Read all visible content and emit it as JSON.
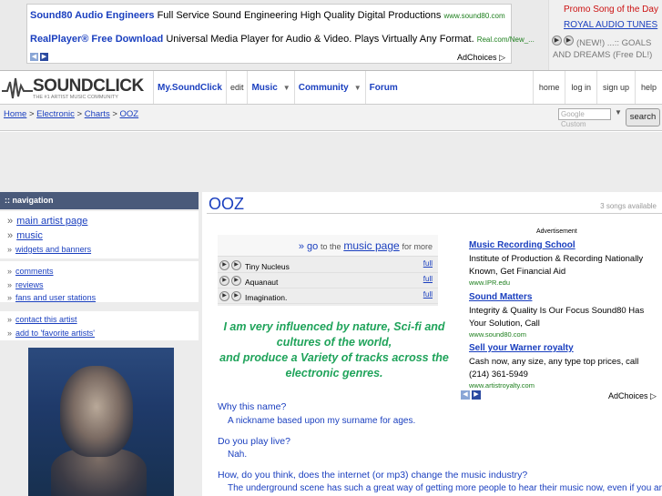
{
  "top_ads": {
    "ads": [
      {
        "title": "Sound80 Audio Engineers",
        "desc": "Full Service Sound Engineering High Quality Digital Productions",
        "url": "www.sound80.com"
      },
      {
        "title": "RealPlayer® Free Download",
        "desc": "Universal Media Player for Audio & Video. Plays Virtually Any Format.",
        "url": "Real.com/New_..."
      }
    ],
    "adchoices": "AdChoices"
  },
  "promo": {
    "heading": "Promo Song of the Day",
    "artist": "ROYAL AUDIO TUNES",
    "song": "(NEW!) ...:: GOALS AND DREAMS (Free DL!)"
  },
  "header": {
    "logo_word": "SOUNDCLICK",
    "logo_sub": "THE #1 ARTIST MUSIC COMMUNITY",
    "nav": {
      "my": "My.SoundClick",
      "edit": "edit",
      "music": "Music",
      "community": "Community",
      "forum": "Forum"
    },
    "right": {
      "home": "home",
      "login": "log in",
      "signup": "sign up",
      "help": "help"
    }
  },
  "breadcrumb": {
    "home": "Home",
    "genre": "Electronic",
    "charts": "Charts",
    "artist": "OOZ",
    "sep": " > "
  },
  "search": {
    "placeholder": "Google Custom",
    "button": "search"
  },
  "sidebar": {
    "heading": ":: navigation",
    "items": [
      "main artist page",
      "music",
      "widgets and banners",
      "comments",
      "reviews",
      "fans and user stations",
      "contact this artist",
      "add to 'favorite artists'"
    ]
  },
  "artist": {
    "name": "OOZ",
    "songs_available": "3 songs available"
  },
  "songbox": {
    "go": "» go",
    "to_the": "to the",
    "music_page": "music page",
    "for_more": "for more"
  },
  "songs": [
    {
      "name": "Tiny Nucleus",
      "full": "full"
    },
    {
      "name": "Aquanaut",
      "full": "full"
    },
    {
      "name": "Imagination.",
      "full": "full"
    }
  ],
  "quote": [
    "I am very influenced by nature, Sci-fi and",
    "cultures of the world,",
    "and produce a Variety of tracks across the",
    "electronic genres."
  ],
  "qa": [
    {
      "q": "Why this name?",
      "a": "A nickname based upon my surname for ages."
    },
    {
      "q": "Do you play live?",
      "a": "Nah."
    },
    {
      "q": "How, do you think, does the internet (or mp3) change the music industry?",
      "a": "The underground scene has such a great way of getting more people to hear their music now, even if you are"
    }
  ],
  "right_ads": {
    "label": "Advertisement",
    "ads": [
      {
        "title": "Music Recording School",
        "desc": "Institute of Production & Recording Nationally Known, Get Financial Aid",
        "url": "www.IPR.edu"
      },
      {
        "title": "Sound Matters",
        "desc": "Integrity & Quality Is Our Focus Sound80 Has Your Solution, Call",
        "url": "www.sound80.com"
      },
      {
        "title": "Sell your Warner royalty",
        "desc": "Cash now, any size, any type top prices, call (214) 361-5949",
        "url": "www.artistroyalty.com"
      }
    ],
    "adchoices": "AdChoices"
  }
}
